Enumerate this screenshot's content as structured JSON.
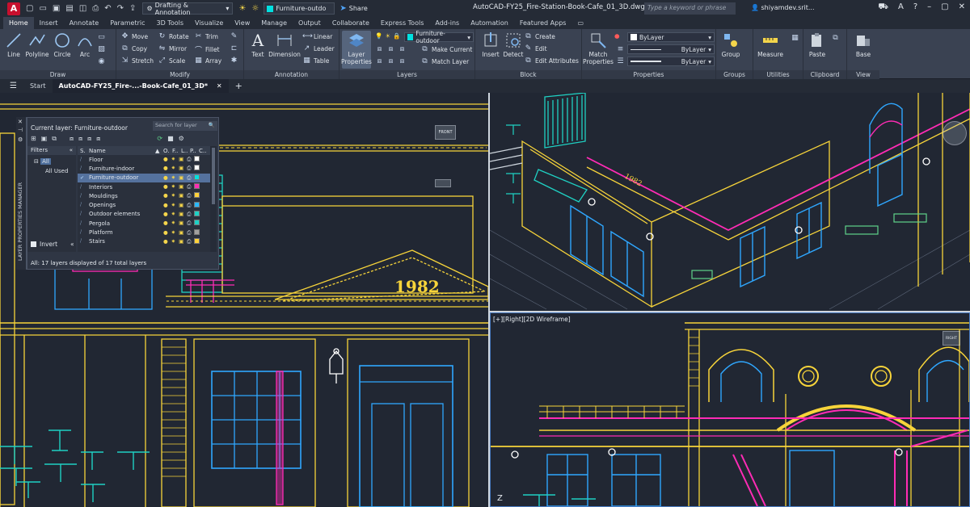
{
  "titlebar": {
    "app_logo": "A",
    "workspace": "Drafting & Annotation",
    "current_layer": "Furniture-outdo",
    "share": "Share",
    "document_title": "AutoCAD-FY25_Fire-Station-Book-Cafe_01_3D.dwg",
    "search_placeholder": "Type a keyword or phrase",
    "user": "shiyamdev.srit..."
  },
  "tabs": [
    "Home",
    "Insert",
    "Annotate",
    "Parametric",
    "3D Tools",
    "Visualize",
    "View",
    "Manage",
    "Output",
    "Collaborate",
    "Express Tools",
    "Add-ins",
    "Automation",
    "Featured Apps"
  ],
  "ribbon": {
    "draw": {
      "title": "Draw",
      "line": "Line",
      "polyline": "Polyline",
      "circle": "Circle",
      "arc": "Arc"
    },
    "modify": {
      "title": "Modify",
      "move": "Move",
      "rotate": "Rotate",
      "trim": "Trim",
      "copy": "Copy",
      "mirror": "Mirror",
      "fillet": "Fillet",
      "stretch": "Stretch",
      "scale": "Scale",
      "array": "Array"
    },
    "annotation": {
      "title": "Annotation",
      "text": "Text",
      "dimension": "Dimension",
      "linear": "Linear",
      "leader": "Leader",
      "table": "Table"
    },
    "layers": {
      "title": "Layers",
      "layer_properties": "Layer\nProperties",
      "layer_combo": "Furniture-outdoor",
      "make_current": "Make Current",
      "match_layer": "Match Layer"
    },
    "block": {
      "title": "Block",
      "insert": "Insert",
      "detect": "Detect",
      "create": "Create",
      "edit": "Edit",
      "edit_attributes": "Edit Attributes"
    },
    "properties": {
      "title": "Properties",
      "match": "Match\nProperties",
      "color": "ByLayer",
      "linetype": "ByLayer",
      "lineweight": "ByLayer"
    },
    "groups": {
      "title": "Groups",
      "group": "Group"
    },
    "utilities": {
      "title": "Utilities",
      "measure": "Measure"
    },
    "clipboard": {
      "title": "Clipboard",
      "paste": "Paste"
    },
    "view": {
      "title": "View",
      "base": "Base"
    }
  },
  "filetabs": {
    "start": "Start",
    "file": "AutoCAD-FY25_Fire-...-Book-Cafe_01_3D*"
  },
  "viewports": {
    "bottom_right_label": "[+][Right][2D Wireframe]",
    "front_cube": "FRONT",
    "right_cube": "RIGHT"
  },
  "layer_manager": {
    "side_title": "LAYER PROPERTIES MANAGER",
    "current_layer": "Current layer: Furniture-outdoor",
    "search_placeholder": "Search for layer",
    "filters_title": "Filters",
    "filter_all": "All",
    "filter_all_used": "All Used",
    "invert": "Invert",
    "col_name": "Name",
    "col_on": "O.",
    "col_freeze": "F..",
    "col_lock": "L..",
    "col_plot": "P..",
    "col_color": "C..",
    "layers": [
      {
        "name": "Floor",
        "color": "#ffffff"
      },
      {
        "name": "Furniture-indoor",
        "color": "#ffffff"
      },
      {
        "name": "Furniture-outdoor",
        "color": "#00e0e0"
      },
      {
        "name": "Interiors",
        "color": "#ff2bb5"
      },
      {
        "name": "Mouldings",
        "color": "#ffd23a"
      },
      {
        "name": "Openings",
        "color": "#29b8ff"
      },
      {
        "name": "Outdoor elements",
        "color": "#1dd1c6"
      },
      {
        "name": "Pergola",
        "color": "#1dd1c6"
      },
      {
        "name": "Platform",
        "color": "#a0a0a0"
      },
      {
        "name": "Stairs",
        "color": "#ffd23a"
      }
    ],
    "status": "All: 17 layers displayed of 17 total layers"
  },
  "drawing": {
    "year_text": "1982"
  }
}
